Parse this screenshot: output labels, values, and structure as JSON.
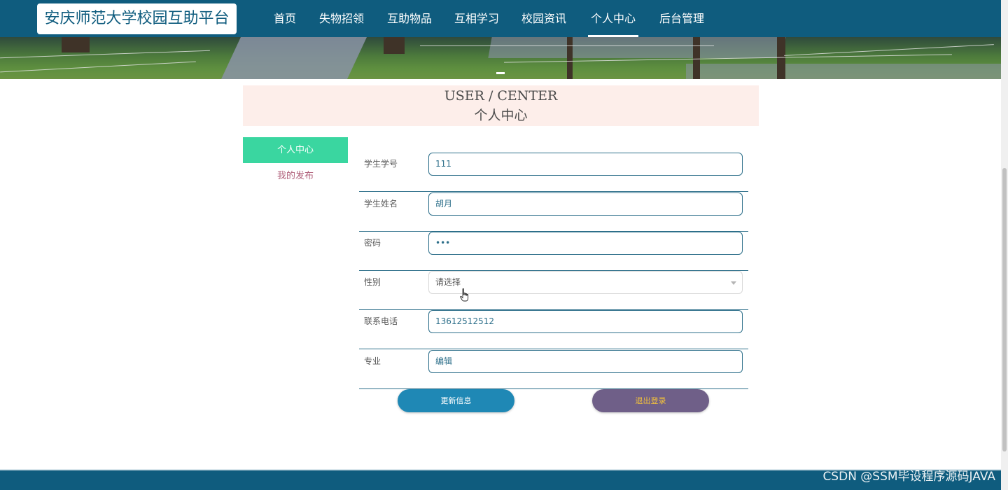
{
  "site": {
    "logo_text": "安庆师范大学校园互助平台"
  },
  "nav": {
    "items": [
      "首页",
      "失物招领",
      "互助物品",
      "互相学习",
      "校园资讯",
      "个人中心",
      "后台管理"
    ],
    "active": "个人中心"
  },
  "section": {
    "title_en": "USER / CENTER",
    "title_cn": "个人中心"
  },
  "sidebar": {
    "items": [
      {
        "label": "个人中心",
        "active": true
      },
      {
        "label": "我的发布",
        "active": false
      }
    ]
  },
  "form": {
    "fields": [
      {
        "label": "学生学号",
        "value": "111"
      },
      {
        "label": "学生姓名",
        "value": "胡月"
      },
      {
        "label": "密码",
        "value": "•••"
      },
      {
        "label": "性别",
        "value": "请选择"
      },
      {
        "label": "联系电话",
        "value": "13612512512"
      },
      {
        "label": "专业",
        "value": "编辑"
      }
    ]
  },
  "buttons": {
    "update": "更新信息",
    "logout": "退出登录"
  },
  "watermark": "CSDN @SSM毕设程序源码JAVA",
  "colors": {
    "primary": "#0f5c7e",
    "menu_active": "#3ad6a0",
    "update_button": "#1f88b5",
    "logout_button": "#6f5f88",
    "logout_text": "#f2c13b"
  },
  "icons": {
    "select_caret": "chevron-down-icon",
    "mouse_cursor": "hand-pointer-icon"
  }
}
